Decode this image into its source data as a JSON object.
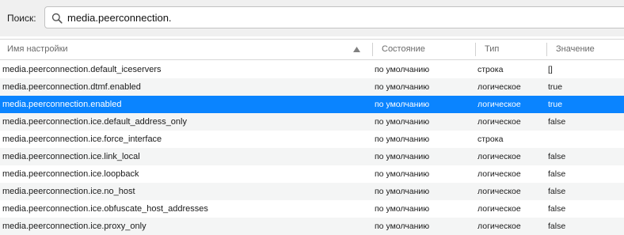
{
  "search": {
    "label": "Поиск:",
    "value": "media.peerconnection.",
    "icon": "search-icon"
  },
  "columns": {
    "name": "Имя настройки",
    "status": "Состояние",
    "type": "Тип",
    "value": "Значение"
  },
  "colors": {
    "selected_row": "#0a84ff",
    "alt_row": "#f4f5f5"
  },
  "rows": [
    {
      "name": "media.peerconnection.default_iceservers",
      "status": "по умолчанию",
      "type": "строка",
      "value": "[]"
    },
    {
      "name": "media.peerconnection.dtmf.enabled",
      "status": "по умолчанию",
      "type": "логическое",
      "value": "true"
    },
    {
      "name": "media.peerconnection.enabled",
      "status": "по умолчанию",
      "type": "логическое",
      "value": "true"
    },
    {
      "name": "media.peerconnection.ice.default_address_only",
      "status": "по умолчанию",
      "type": "логическое",
      "value": "false"
    },
    {
      "name": "media.peerconnection.ice.force_interface",
      "status": "по умолчанию",
      "type": "строка",
      "value": ""
    },
    {
      "name": "media.peerconnection.ice.link_local",
      "status": "по умолчанию",
      "type": "логическое",
      "value": "false"
    },
    {
      "name": "media.peerconnection.ice.loopback",
      "status": "по умолчанию",
      "type": "логическое",
      "value": "false"
    },
    {
      "name": "media.peerconnection.ice.no_host",
      "status": "по умолчанию",
      "type": "логическое",
      "value": "false"
    },
    {
      "name": "media.peerconnection.ice.obfuscate_host_addresses",
      "status": "по умолчанию",
      "type": "логическое",
      "value": "false"
    },
    {
      "name": "media.peerconnection.ice.proxy_only",
      "status": "по умолчанию",
      "type": "логическое",
      "value": "false"
    }
  ]
}
